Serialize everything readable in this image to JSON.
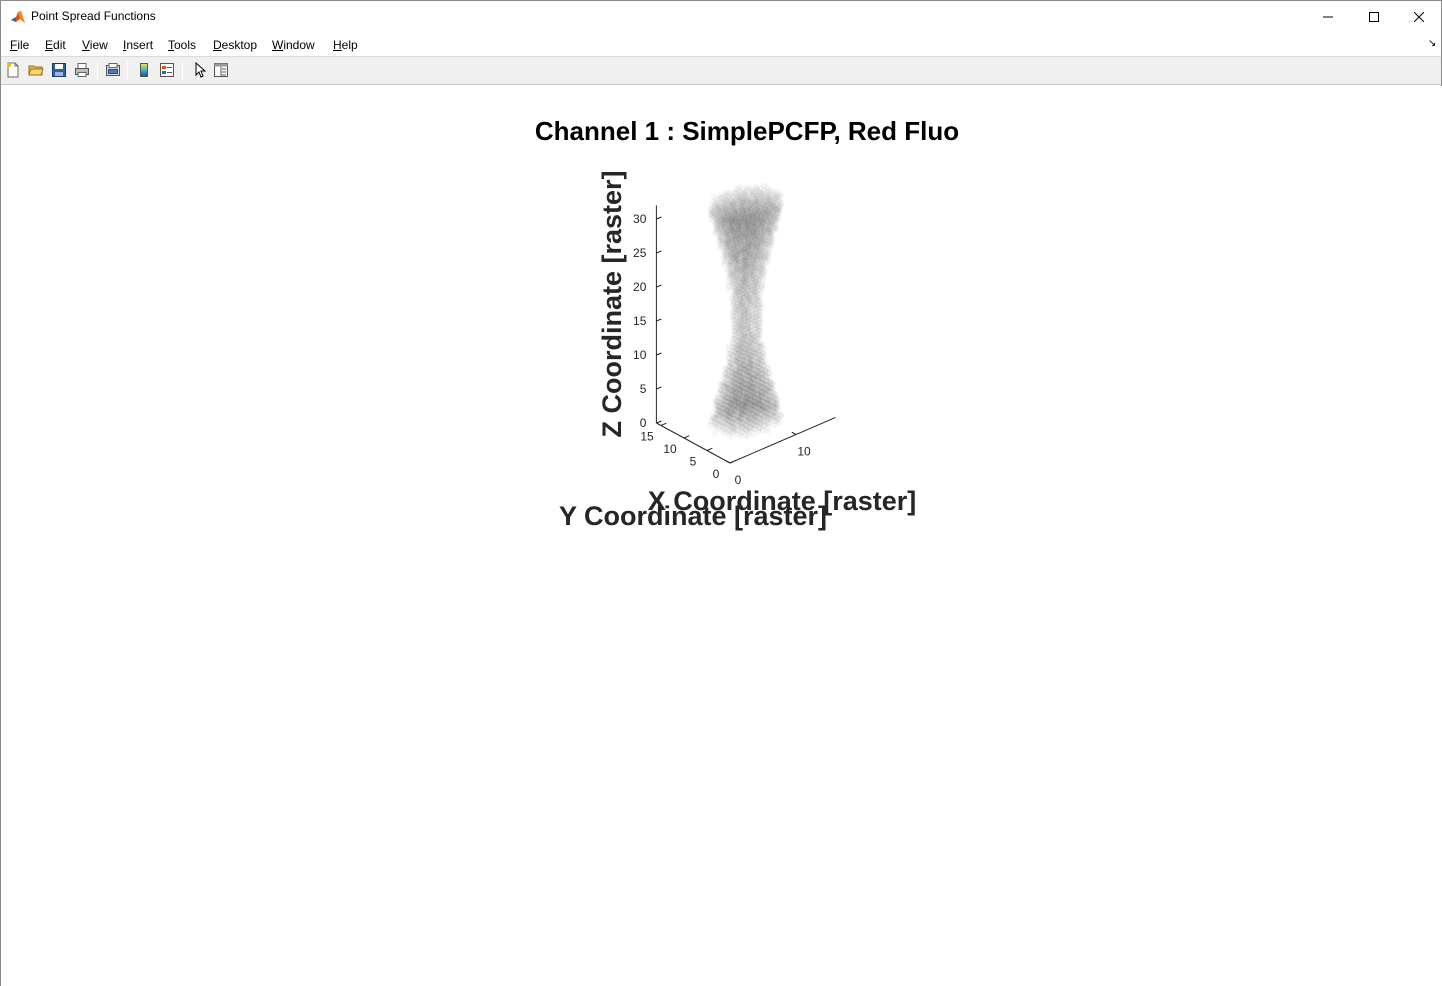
{
  "window": {
    "title": "Point Spread Functions",
    "icon": "matlab-logo-icon"
  },
  "menu": [
    "File",
    "Edit",
    "View",
    "Insert",
    "Tools",
    "Desktop",
    "Window",
    "Help"
  ],
  "toolbar": {
    "buttons": [
      "new-figure-icon",
      "open-file-icon",
      "save-icon",
      "print-icon",
      "print-preview-icon",
      "insert-colorbar-icon",
      "insert-legend-icon",
      "edit-plot-icon",
      "property-inspector-icon"
    ]
  },
  "chart_data": {
    "type": "scatter",
    "title": "Channel 1 : SimplePCFP, Red Fluo",
    "xlabel": "X Coordinate [raster]",
    "ylabel": "Y Coordinate [raster]",
    "zlabel": "Z Coordinate [raster]",
    "x_ticks": [
      "0",
      "10"
    ],
    "y_ticks": [
      "0",
      "5",
      "10",
      "15"
    ],
    "z_ticks": [
      "0",
      "5",
      "10",
      "15",
      "20",
      "25",
      "30"
    ],
    "xlim": [
      0,
      16
    ],
    "ylim": [
      0,
      16
    ],
    "zlim": [
      0,
      32
    ],
    "grid": false,
    "series": [
      {
        "description": "semi-transparent gray 3D voxel point cloud of the point spread function, narrow waist near z=15, widening toward z=0 and z=32",
        "color": "#505050",
        "profile": [
          {
            "z": 0,
            "half_width": 4.5
          },
          {
            "z": 4,
            "half_width": 3.6
          },
          {
            "z": 8,
            "half_width": 2.6
          },
          {
            "z": 12,
            "half_width": 2.0
          },
          {
            "z": 16,
            "half_width": 1.9
          },
          {
            "z": 20,
            "half_width": 2.2
          },
          {
            "z": 24,
            "half_width": 2.9
          },
          {
            "z": 28,
            "half_width": 3.8
          },
          {
            "z": 32,
            "half_width": 4.8
          }
        ],
        "center": {
          "x": 8,
          "y": 8
        }
      }
    ]
  }
}
